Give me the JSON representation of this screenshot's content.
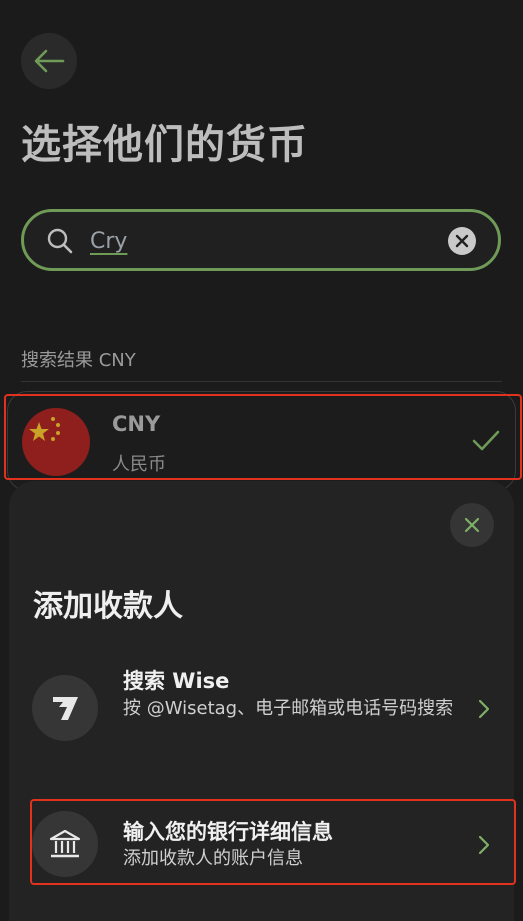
{
  "header": {
    "title": "选择他们的货币"
  },
  "search": {
    "value": "Cry"
  },
  "results": {
    "label": "搜索结果 CNY",
    "items": [
      {
        "code": "CNY",
        "name": "人民币",
        "selected": true
      }
    ]
  },
  "sheet": {
    "title": "添加收款人",
    "options": [
      {
        "title": "搜索 Wise",
        "description": "按 @Wisetag、电子邮箱或电话号码搜索"
      },
      {
        "title": "输入您的银行详细信息",
        "description": "添加收款人的账户信息"
      }
    ]
  },
  "colors": {
    "accent": "#6f9a57",
    "highlight": "#e0321c",
    "background": "#1b1b1b"
  },
  "icons": [
    "arrow-left-icon",
    "search-icon",
    "clear-icon",
    "china-flag-icon",
    "check-icon",
    "close-icon",
    "wise-logo-icon",
    "bank-icon",
    "chevron-right-icon"
  ]
}
